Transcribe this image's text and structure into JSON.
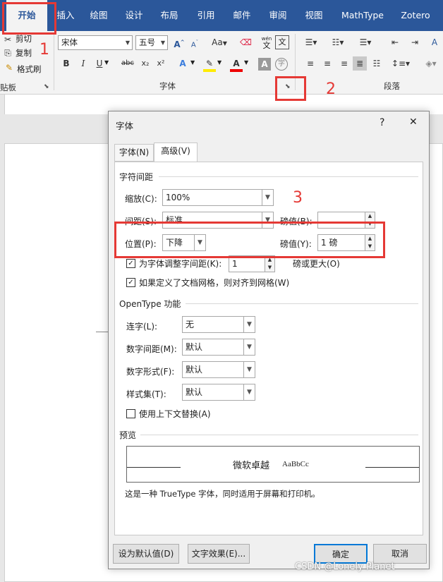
{
  "ribbon": {
    "tabs": [
      "开始",
      "插入",
      "绘图",
      "设计",
      "布局",
      "引用",
      "邮件",
      "审阅",
      "视图",
      "MathType",
      "Zotero"
    ],
    "clipboard": {
      "cut": "剪切",
      "copy": "复制",
      "format_painter": "格式刷",
      "group": "贴板"
    },
    "font": {
      "name": "宋体",
      "size": "五号",
      "group": "字体",
      "bold": "B",
      "italic": "I",
      "underline": "U",
      "strike": "abc",
      "sub": "x₂",
      "sup": "x²",
      "wen": "wén",
      "wen_char": "文",
      "zi": "字",
      "aa": "Aa"
    },
    "paragraph": {
      "group": "段落"
    }
  },
  "annotations": {
    "one": "1",
    "two": "2",
    "three": "3"
  },
  "dialog": {
    "title": "字体",
    "help": "?",
    "close": "✕",
    "tabs": [
      "字体(N)",
      "高级(V)"
    ],
    "spacing_section": "字符间距",
    "scale": {
      "label": "缩放(C):",
      "value": "100%"
    },
    "spacing": {
      "label": "间距(S):",
      "value": "标准",
      "by_label": "磅值(B):",
      "by_value": ""
    },
    "position": {
      "label": "位置(P):",
      "value": "下降",
      "by_label": "磅值(Y):",
      "by_value": "1 磅"
    },
    "kerning": {
      "label": "为字体调整字间距(K):",
      "value": "1",
      "suffix": "磅或更大(O)",
      "checked": true
    },
    "grid": {
      "label": "如果定义了文档网格，则对齐到网格(W)",
      "checked": true
    },
    "opentype_section": "OpenType 功能",
    "ligatures": {
      "label": "连字(L):",
      "value": "无"
    },
    "num_spacing": {
      "label": "数字间距(M):",
      "value": "默认"
    },
    "num_forms": {
      "label": "数字形式(F):",
      "value": "默认"
    },
    "stylistic_sets": {
      "label": "样式集(T):",
      "value": "默认"
    },
    "contextual": {
      "label": "使用上下文替换(A)",
      "checked": false
    },
    "preview_section": "预览",
    "preview_text": "微软卓越",
    "preview_latin": "AaBbCc",
    "preview_note": "这是一种 TrueType 字体，同时适用于屏幕和打印机。",
    "buttons": {
      "set_default": "设为默认值(D)",
      "text_effects": "文字效果(E)...",
      "ok": "确定",
      "cancel": "取消"
    }
  },
  "watermark": "CSDN @Lonely Planet"
}
